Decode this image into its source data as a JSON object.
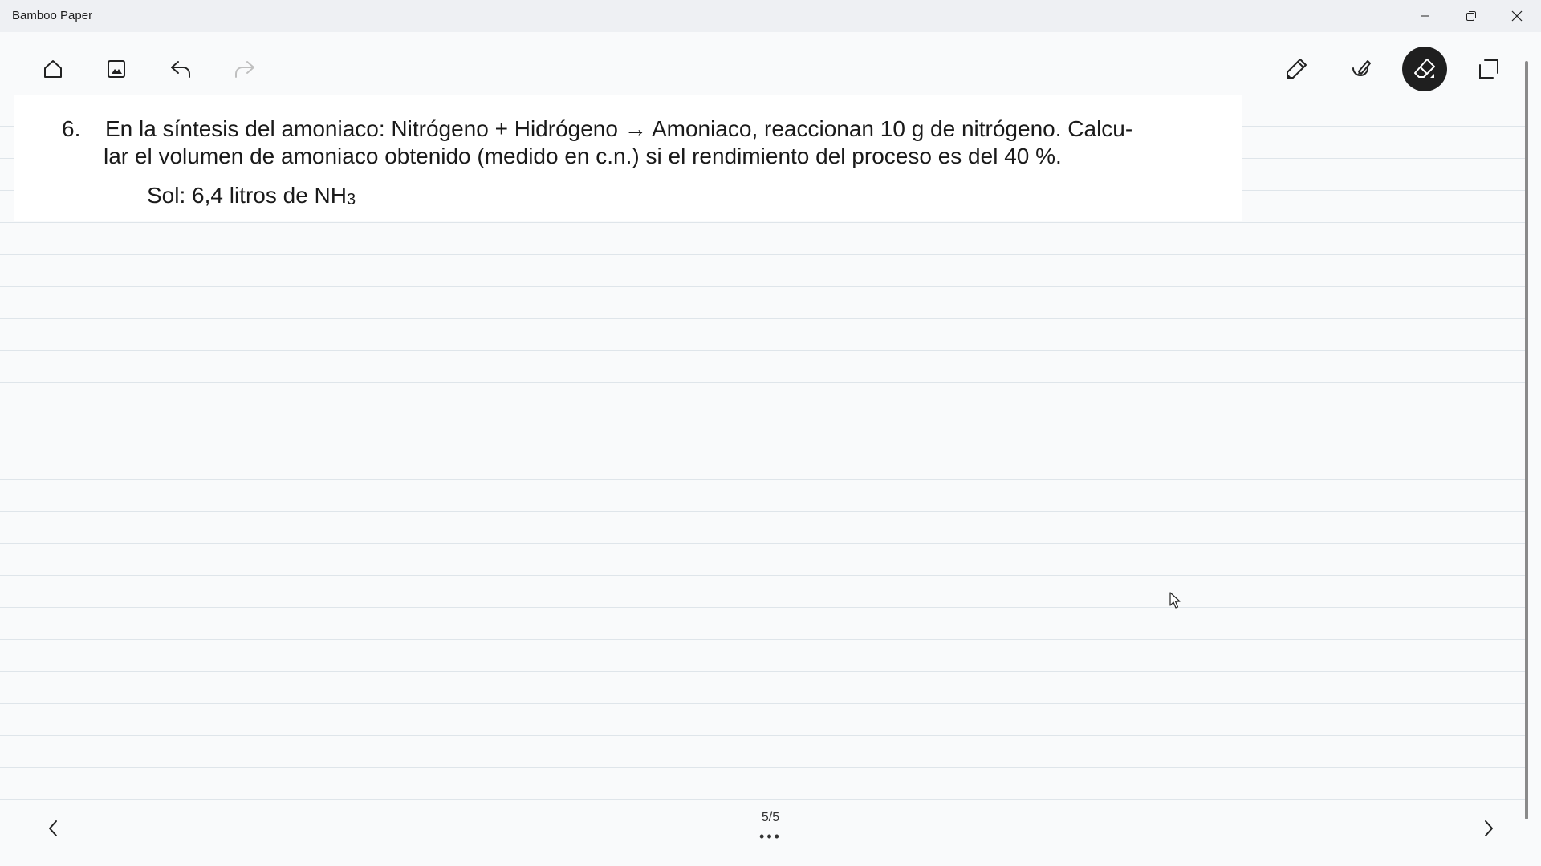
{
  "window": {
    "title": "Bamboo Paper"
  },
  "toolbar": {
    "left_tools": [
      "home-icon",
      "insert-image-icon",
      "undo-icon",
      "redo-icon"
    ],
    "right_tools": [
      "pen-icon",
      "highlighter-icon",
      "eraser-icon",
      "crop-icon"
    ],
    "active_tool": "eraser"
  },
  "page": {
    "question_number": "6.",
    "question_line1": "En la síntesis del amoniaco: Nitrógeno + Hidrógeno → Amoniaco, reaccionan 10 g de nitrógeno. Calcu-",
    "question_line2": "lar el volumen de amoniaco obtenido (medido en c.n.) si el rendimiento del proceso es del 40 %.",
    "solution_prefix": "Sol: 6,4 litros de NH",
    "solution_subscript": "3"
  },
  "footer": {
    "page_indicator": "5/5",
    "more_label": "•••"
  }
}
